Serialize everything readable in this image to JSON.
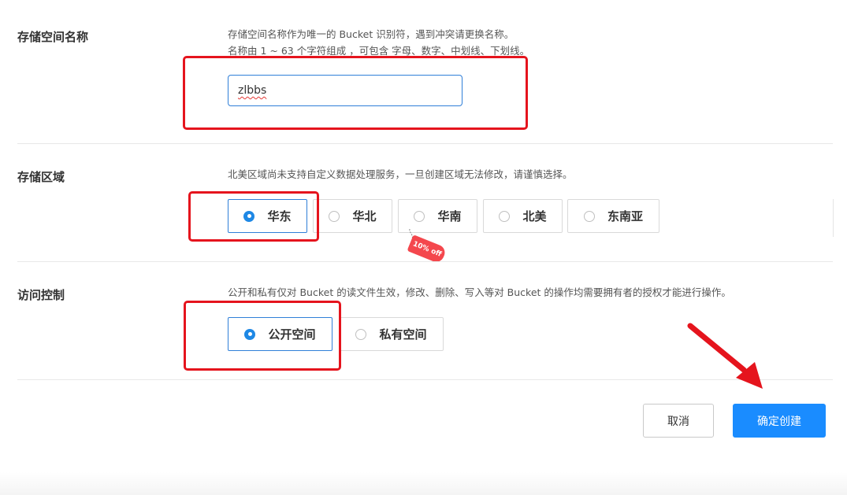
{
  "bucket_name": {
    "label": "存储空间名称",
    "desc_line1": "存储空间名称作为唯一的 Bucket 识别符，遇到冲突请更换名称。",
    "desc_line2": "名称由 1 ~ 63 个字符组成 ，可包含 字母、数字、中划线、下划线。",
    "value": "zlbbs"
  },
  "region": {
    "label": "存储区域",
    "desc": "北美区域尚未支持自定义数据处理服务，一旦创建区域无法修改，请谨慎选择。",
    "options": [
      {
        "label": "华东",
        "selected": true
      },
      {
        "label": "华北",
        "selected": false
      },
      {
        "label": "华南",
        "selected": false
      },
      {
        "label": "北美",
        "selected": false
      },
      {
        "label": "东南亚",
        "selected": false
      }
    ],
    "discount_tag": "10% off"
  },
  "access": {
    "label": "访问控制",
    "desc": "公开和私有仅对 Bucket 的读文件生效，修改、删除、写入等对 Bucket 的操作均需要拥有者的授权才能进行操作。",
    "options": [
      {
        "label": "公开空间",
        "selected": true
      },
      {
        "label": "私有空间",
        "selected": false
      }
    ]
  },
  "actions": {
    "cancel_label": "取消",
    "confirm_label": "确定创建"
  },
  "colors": {
    "accent": "#1a8cff",
    "annotation_red": "#e5141d",
    "tag": "#f4474d"
  }
}
